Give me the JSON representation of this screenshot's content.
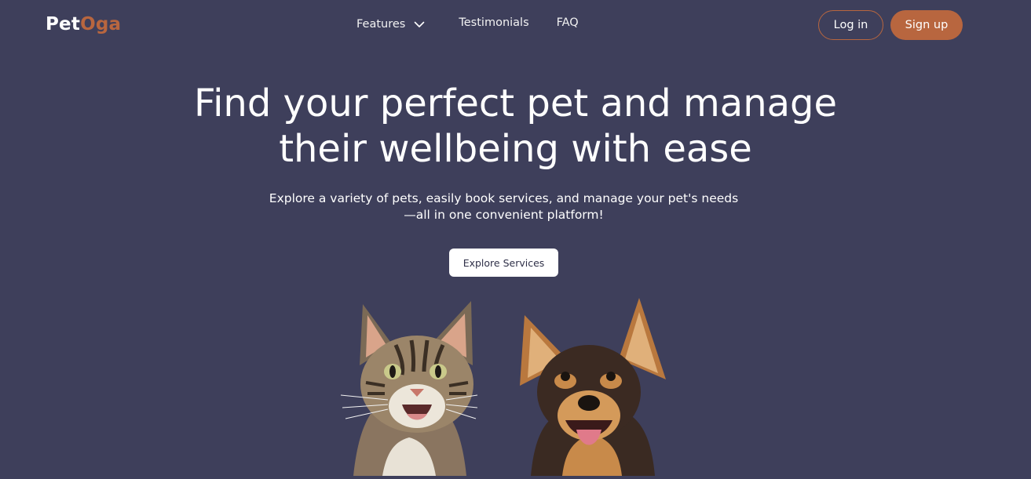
{
  "brand": {
    "name_part1": "Pet",
    "name_part2": "Oga",
    "accent_color": "#b8663f",
    "background_color": "#3e3f5b"
  },
  "nav": {
    "features": "Features",
    "features_icon": "chevron-down-icon",
    "testimonials": "Testimonials",
    "faq": "FAQ"
  },
  "auth": {
    "login": "Log in",
    "signup": "Sign up"
  },
  "hero": {
    "title_line1": "Find your perfect pet and manage",
    "title_line2": "their wellbeing with ease",
    "subtitle_line1": "Explore a variety of pets, easily book services, and manage your pet's needs",
    "subtitle_line2": "—all in one convenient platform!",
    "cta": "Explore Services"
  },
  "images": {
    "cat": "tabby-cat-photo",
    "dog": "dog-photo"
  }
}
